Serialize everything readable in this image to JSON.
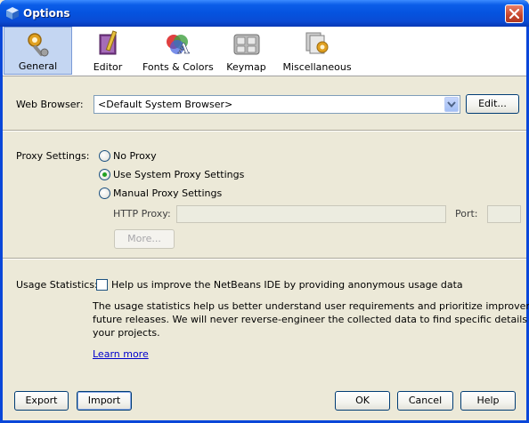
{
  "window": {
    "title": "Options"
  },
  "toolbar": {
    "items": [
      {
        "label": "General",
        "icon": "wrench-gear-icon",
        "selected": true
      },
      {
        "label": "Editor",
        "icon": "pen-book-icon",
        "selected": false
      },
      {
        "label": "Fonts & Colors",
        "icon": "fonts-colors-icon",
        "selected": false
      },
      {
        "label": "Keymap",
        "icon": "keyboard-icon",
        "selected": false
      },
      {
        "label": "Miscellaneous",
        "icon": "miscellaneous-icon",
        "selected": false
      }
    ]
  },
  "web_browser": {
    "label": "Web Browser:",
    "value": "<Default System Browser>",
    "edit_label": "Edit..."
  },
  "proxy": {
    "label": "Proxy Settings:",
    "options": [
      {
        "label": "No Proxy",
        "selected": false
      },
      {
        "label": "Use System Proxy Settings",
        "selected": true
      },
      {
        "label": "Manual Proxy Settings",
        "selected": false
      }
    ],
    "http_proxy_label": "HTTP Proxy:",
    "http_proxy_value": "",
    "port_label": "Port:",
    "port_value": "",
    "more_label": "More..."
  },
  "usage": {
    "label": "Usage Statistics:",
    "checkbox_label": "Help us improve the NetBeans IDE by providing anonymous usage data",
    "checked": false,
    "description_line1": "The usage statistics help us better understand user requirements and prioritize improvements in",
    "description_line2": "future releases. We will never reverse-engineer the collected data to find specific details about",
    "description_line3": "your projects.",
    "learn_more": "Learn more"
  },
  "footer": {
    "export_label": "Export",
    "import_label": "Import",
    "ok_label": "OK",
    "cancel_label": "Cancel",
    "help_label": "Help"
  },
  "colors": {
    "titlebar": "#0553df",
    "selected_tab": "#c4d6f2",
    "dialog_background": "#ece9d8",
    "link": "#0000cc"
  }
}
